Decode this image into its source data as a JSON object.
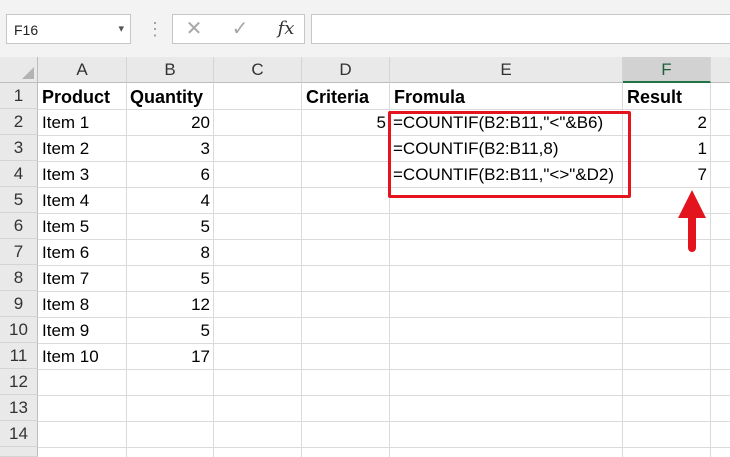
{
  "formula_bar": {
    "name_box": "F16",
    "name_box_arrow": "▾",
    "dots": "⋮",
    "cancel_icon": "✕",
    "enter_icon": "✓",
    "fx_label": "fx",
    "formula_value": ""
  },
  "columns": [
    "A",
    "B",
    "C",
    "D",
    "E",
    "F"
  ],
  "selected_column": "F",
  "rows": [
    "1",
    "2",
    "3",
    "4",
    "5",
    "6",
    "7",
    "8",
    "9",
    "10",
    "11",
    "12",
    "13",
    "14"
  ],
  "headers": {
    "A": "Product",
    "B": "Quantity",
    "D": "Criteria",
    "E": "Fromula",
    "F": "Result"
  },
  "products": [
    "Item 1",
    "Item 2",
    "Item 3",
    "Item 4",
    "Item 5",
    "Item 6",
    "Item 7",
    "Item 8",
    "Item 9",
    "Item 10"
  ],
  "quantities": [
    "20",
    "3",
    "6",
    "4",
    "5",
    "8",
    "5",
    "12",
    "5",
    "17"
  ],
  "criteria": [
    "5"
  ],
  "formulas": [
    "=COUNTIF(B2:B11,\"<\"&B6)",
    "=COUNTIF(B2:B11,8)",
    "=COUNTIF(B2:B11,\"<>\"&D2)"
  ],
  "results": [
    "2",
    "1",
    "7"
  ],
  "annotation": {
    "box_color": "#e4141e",
    "arrow_color": "#e4141e"
  }
}
